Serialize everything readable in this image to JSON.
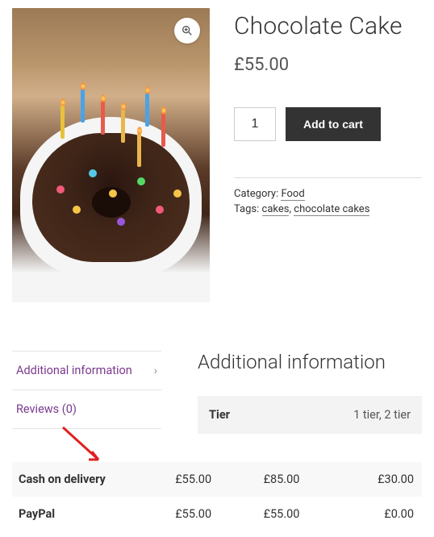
{
  "product": {
    "title": "Chocolate Cake",
    "price": "£55.00",
    "qty": "1",
    "add_label": "Add to cart",
    "category_label": "Category:",
    "category_link": "Food",
    "tags_label": "Tags:",
    "tag1": "cakes",
    "tag_sep": ", ",
    "tag2": "chocolate cakes"
  },
  "tabs": {
    "addl": "Additional information",
    "reviews": "Reviews (0)"
  },
  "content": {
    "heading": "Additional information",
    "attr_label": "Tier",
    "attr_value": "1 tier, 2 tier"
  },
  "pricing": {
    "row1_label": "Cash on delivery",
    "row1_c1": "£55.00",
    "row1_c2": "£85.00",
    "row1_c3": "£30.00",
    "row2_label": "PayPal",
    "row2_c1": "£55.00",
    "row2_c2": "£55.00",
    "row2_c3": "£0.00"
  }
}
